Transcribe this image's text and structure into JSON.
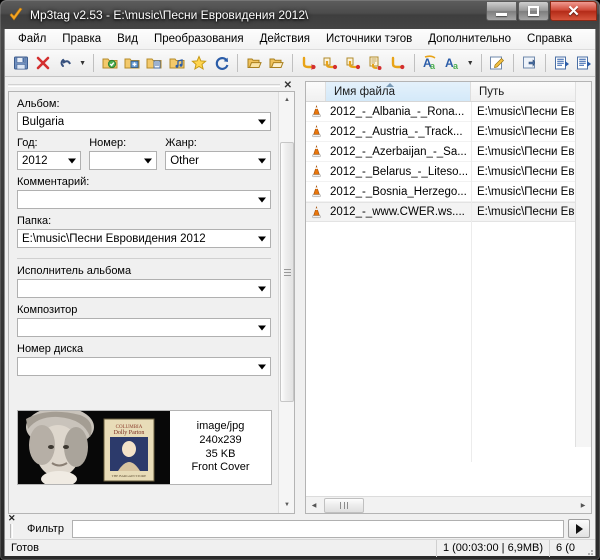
{
  "window": {
    "title": "Mp3tag v2.53  -  E:\\music\\Песни Евровидения 2012\\",
    "icon": "mp3tag-logo-icon",
    "buttons": {
      "minimize": "–",
      "maximize": "□",
      "close": "✕"
    }
  },
  "menubar": {
    "items": [
      {
        "label": "Файл"
      },
      {
        "label": "Правка"
      },
      {
        "label": "Вид"
      },
      {
        "label": "Преобразования"
      },
      {
        "label": "Действия"
      },
      {
        "label": "Источники тэгов"
      },
      {
        "label": "Дополнительно"
      },
      {
        "label": "Справка"
      }
    ]
  },
  "toolbar": {
    "groups": [
      [
        "save-icon",
        "remove-tag-icon",
        "undo-icon",
        "undo-dropdown-icon"
      ],
      [
        "change-directory-icon",
        "add-directory-icon",
        "add-files-icon",
        "open-playlist-icon",
        "favorites-icon",
        "refresh-icon"
      ],
      [
        "copy-tag-icon",
        "paste-tag-icon"
      ],
      [
        "filename-from-tag-icon",
        "tag-from-filename-icon",
        "tag-from-tag-icon",
        "text-file-icon",
        "filename-from-filename-icon"
      ],
      [
        "case-conversion-icon",
        "replace-case-icon",
        "case-dropdown-icon"
      ],
      [
        "edit-icon"
      ],
      [
        "actions-icon"
      ],
      [
        "playlist-export-icon",
        "playlist-copy-icon"
      ]
    ]
  },
  "tagpanel": {
    "close_label": "✕",
    "fields": [
      {
        "name": "album",
        "label": "Альбом:",
        "value": "Bulgaria",
        "placeholder": ""
      },
      {
        "name": "year",
        "label": "Год:",
        "value": "2012",
        "placeholder": ""
      },
      {
        "name": "track",
        "label": "Номер:",
        "value": "",
        "placeholder": ""
      },
      {
        "name": "genre",
        "label": "Жанр:",
        "value": "Other",
        "placeholder": ""
      },
      {
        "name": "comment",
        "label": "Комментарий:",
        "value": "",
        "placeholder": ""
      },
      {
        "name": "folder",
        "label": "Папка:",
        "value": "E:\\music\\Песни Евровидения 2012",
        "placeholder": ""
      },
      {
        "name": "album_artist",
        "label": "Исполнитель альбома",
        "value": "",
        "placeholder": ""
      },
      {
        "name": "composer",
        "label": "Композитор",
        "value": "",
        "placeholder": ""
      },
      {
        "name": "disc_number",
        "label": "Номер диска",
        "value": "",
        "placeholder": ""
      }
    ],
    "cover": {
      "mime": "image/jpg",
      "dimensions": "240x239",
      "filesize": "35 KB",
      "type": "Front Cover"
    }
  },
  "filelist": {
    "columns": [
      {
        "key": "icon",
        "label": ""
      },
      {
        "key": "filename",
        "label": "Имя файла",
        "sorted": "asc"
      },
      {
        "key": "path",
        "label": "Путь"
      }
    ],
    "rows": [
      {
        "icon": "vlc-cone-icon",
        "filename": "2012_-_Albania_-_Rona...",
        "path": "E:\\music\\Песни Евро",
        "selected": false
      },
      {
        "icon": "vlc-cone-icon",
        "filename": "2012_-_Austria_-_Track...",
        "path": "E:\\music\\Песни Евро",
        "selected": false
      },
      {
        "icon": "vlc-cone-icon",
        "filename": "2012_-_Azerbaijan_-_Sa...",
        "path": "E:\\music\\Песни Евро",
        "selected": false
      },
      {
        "icon": "vlc-cone-icon",
        "filename": "2012_-_Belarus_-_Liteso...",
        "path": "E:\\music\\Песни Евро",
        "selected": false
      },
      {
        "icon": "vlc-cone-icon",
        "filename": "2012_-_Bosnia_Herzego...",
        "path": "E:\\music\\Песни Евро",
        "selected": false
      },
      {
        "icon": "vlc-cone-icon",
        "filename": "2012_-_www.CWER.ws....",
        "path": "E:\\music\\Песни Евро",
        "selected": true
      }
    ]
  },
  "filterbar": {
    "close_label": "✕",
    "label": "Фильтр",
    "value": "",
    "placeholder": "",
    "go_label": "▶"
  },
  "statusbar": {
    "status": "Готов",
    "selection_info": "1 (00:03:00 | 6,9MB)",
    "total_info": "6 (0"
  },
  "colors": {
    "accent": "#d4e9f9",
    "panel_bg": "#f0f0f0",
    "field_bg": "#ffffff",
    "close_red": "#b32b18",
    "vlc_orange": "#e8760c"
  }
}
